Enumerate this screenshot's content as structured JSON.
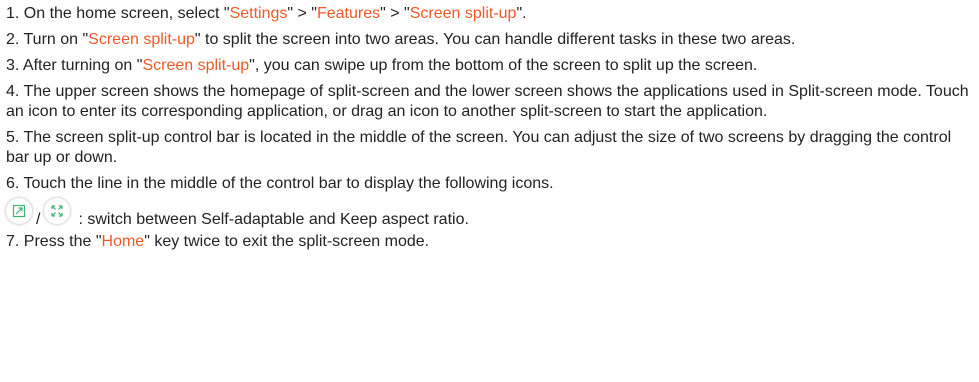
{
  "steps": [
    {
      "num": "1. ",
      "parts": [
        {
          "t": "On the home screen, select \""
        },
        {
          "t": "Settings",
          "hl": true
        },
        {
          "t": "\" > \""
        },
        {
          "t": "Features",
          "hl": true
        },
        {
          "t": "\" > \""
        },
        {
          "t": "Screen split-up",
          "hl": true
        },
        {
          "t": "\"."
        }
      ]
    },
    {
      "num": "2. ",
      "parts": [
        {
          "t": "Turn on \""
        },
        {
          "t": "Screen split-up",
          "hl": true
        },
        {
          "t": "\" to split the screen into two areas. You can handle different tasks in these two areas."
        }
      ]
    },
    {
      "num": "3. ",
      "parts": [
        {
          "t": "After turning on \""
        },
        {
          "t": "Screen split-up",
          "hl": true
        },
        {
          "t": "\", you can swipe up from the bottom of the screen to split up the screen."
        }
      ]
    },
    {
      "num": "4. ",
      "parts": [
        {
          "t": "The upper screen shows the homepage of split-screen and the lower screen shows the applications used in Split-screen mode. Touch an icon to enter its corresponding application, or drag an icon to another split-screen to start the application."
        }
      ]
    },
    {
      "num": "5. ",
      "parts": [
        {
          "t": "The screen split-up control bar is located in the middle of the screen. You can adjust the size of two screens by dragging the control bar up or down."
        }
      ]
    },
    {
      "num": "6. ",
      "parts": [
        {
          "t": "Touch the line in the middle of the control bar to display the following icons."
        }
      ]
    }
  ],
  "icon_row": {
    "icon1": "self-adaptable-icon",
    "separator": "/",
    "icon2": "keep-aspect-ratio-icon",
    "description": ": switch between Self-adaptable and Keep aspect ratio."
  },
  "step7": {
    "num": "7. ",
    "parts": [
      {
        "t": "Press the \""
      },
      {
        "t": "Home",
        "hl": true
      },
      {
        "t": "\" key twice to exit the split-screen mode."
      }
    ]
  },
  "colors": {
    "highlight": "#f05a28",
    "text": "#222222",
    "icon_green": "#3cb371"
  }
}
